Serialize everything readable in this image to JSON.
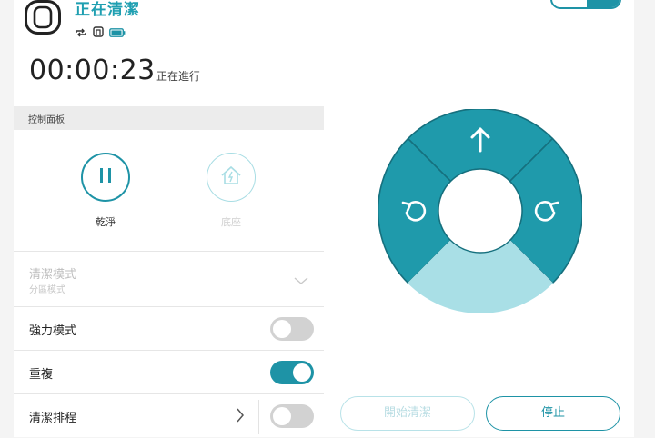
{
  "header": {
    "status_title": "正在清潔",
    "icons": [
      "robot-vacuum-icon",
      "repeat-icon",
      "cleaning-mode-icon",
      "battery-icon"
    ]
  },
  "timer": {
    "elapsed": "00:00:23",
    "status": "正在進行"
  },
  "control_panel": {
    "title": "控制面板",
    "clean_button_label": "乾淨",
    "dock_button_label": "底座"
  },
  "settings": {
    "cleaning_mode": {
      "label": "清潔模式",
      "value": "分區模式"
    },
    "strong_mode": {
      "label": "強力模式",
      "on": false
    },
    "repeat": {
      "label": "重複",
      "on": true
    },
    "schedule": {
      "label": "清潔排程",
      "on": false
    }
  },
  "dpad": {
    "icons": [
      "up-arrow-icon",
      "rotate-left-icon",
      "rotate-right-icon"
    ],
    "bottom_segment_active": true
  },
  "actions": {
    "start_label": "開始清潔",
    "stop_label": "停止"
  },
  "colors": {
    "accent": "#1e93a6",
    "accent_light": "#a9dfe6",
    "toggle_off": "#d2d2d2"
  }
}
